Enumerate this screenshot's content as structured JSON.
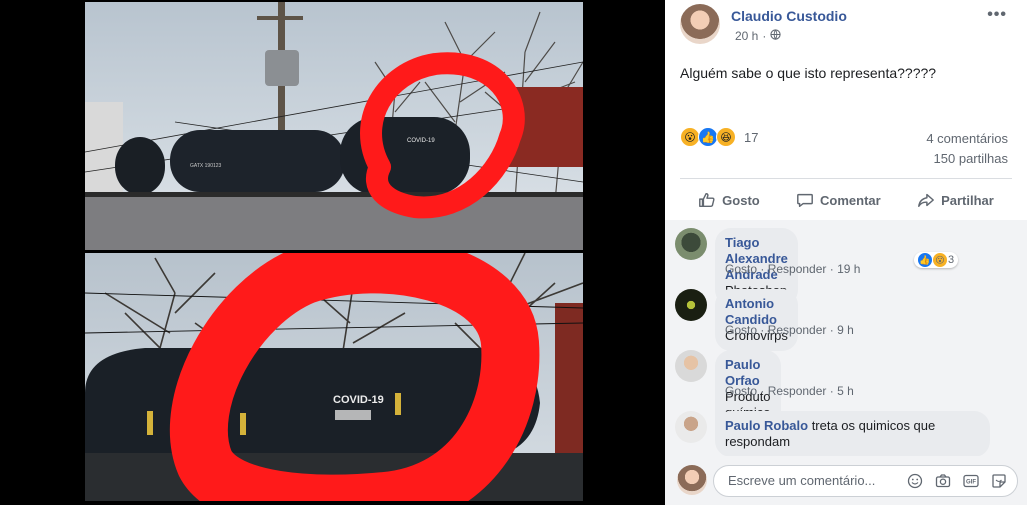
{
  "photo": {
    "top_label": "COVID-19",
    "bottom_label": "COVID-19",
    "car_mark_1": "GATX 190123"
  },
  "post": {
    "author": "Claudio Custodio",
    "time": "20 h",
    "dot": "·",
    "text": "Alguém sabe o que isto representa?????",
    "reaction_count": "17",
    "comments_count": "4 comentários",
    "shares_count": "150 partilhas",
    "more": "•••"
  },
  "actions": {
    "like": "Gosto",
    "comment": "Comentar",
    "share": "Partilhar"
  },
  "comments": [
    {
      "name": "Tiago Alexandre Andrade",
      "text": "Photoshop",
      "like": "Gosto",
      "reply": "Responder",
      "time": "19 h",
      "reactions": "3"
    },
    {
      "name": "Antonio Candido",
      "text": "Cronovirps",
      "like": "Gosto",
      "reply": "Responder",
      "time": "9 h"
    },
    {
      "name": "Paulo Orfao",
      "text": "Produto químico",
      "emoji": "😉",
      "like": "Gosto",
      "reply": "Responder",
      "time": "5 h"
    },
    {
      "name": "Paulo Robalo",
      "text": "treta os quimicos que respondam"
    }
  ],
  "compose": {
    "placeholder": "Escreve um comentário...",
    "gif_label": "GIF"
  },
  "colors": {
    "link": "#385898",
    "secondary": "#606770",
    "marker_red": "#ff1a1a",
    "panel_bg": "#f2f3f5"
  },
  "icons": [
    "more-icon",
    "globe-icon",
    "like-icon",
    "comment-icon",
    "share-icon",
    "emoji-icon",
    "camera-icon",
    "gif-icon",
    "sticker-icon"
  ]
}
